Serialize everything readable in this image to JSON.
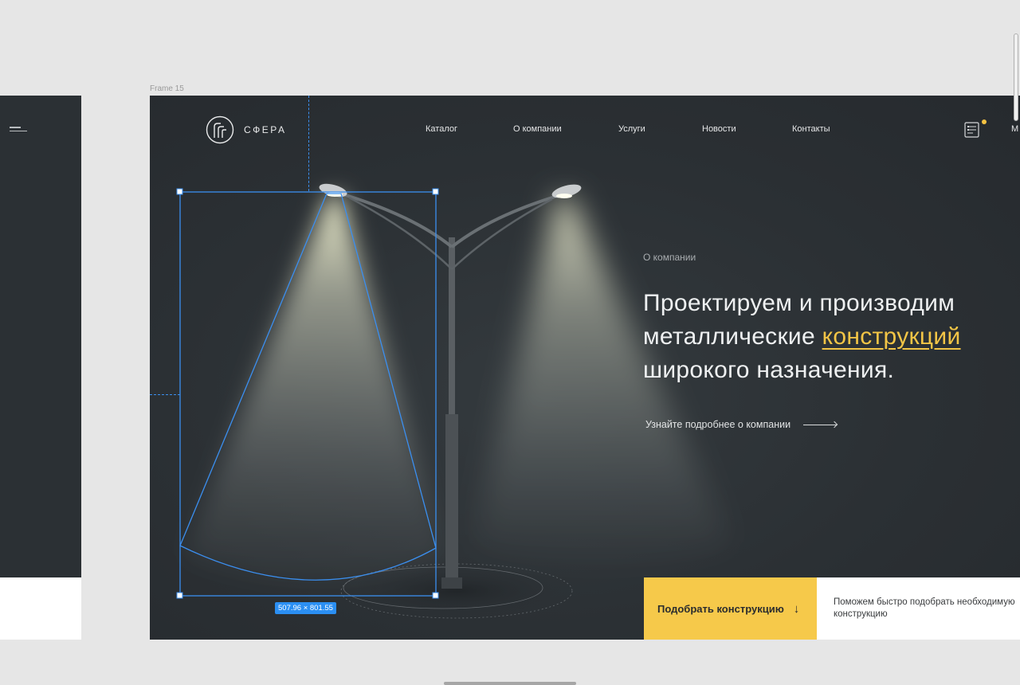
{
  "canvas": {
    "frame_label": "Frame 15"
  },
  "header": {
    "logo_text": "СФЕРА",
    "nav": [
      "Каталог",
      "О компании",
      "Услуги",
      "Новости",
      "Контакты"
    ],
    "right_cut_text": "М"
  },
  "hero": {
    "section_label": "О компании",
    "headline_line1": "Проектируем и производим",
    "headline_line2_prefix": "металлические ",
    "headline_highlight": "конструкций",
    "headline_line3": "широкого назначения.",
    "more_link": "Узнайте подробнее о компании"
  },
  "selection": {
    "size_label": "507.96 × 801.55"
  },
  "cta": {
    "button_label": "Подобрать конструкцию",
    "button_arrow": "↓",
    "note": "Поможем быстро подобрать необходимую конструкцию"
  },
  "colors": {
    "background": "#2b3034",
    "accent": "#f6c94a",
    "selection": "#2b8ff3",
    "canvas": "#e6e6e6"
  },
  "icons": [
    "menu-icon",
    "logo-icon",
    "cart-icon",
    "arrow-right-icon",
    "arrow-down-icon"
  ]
}
